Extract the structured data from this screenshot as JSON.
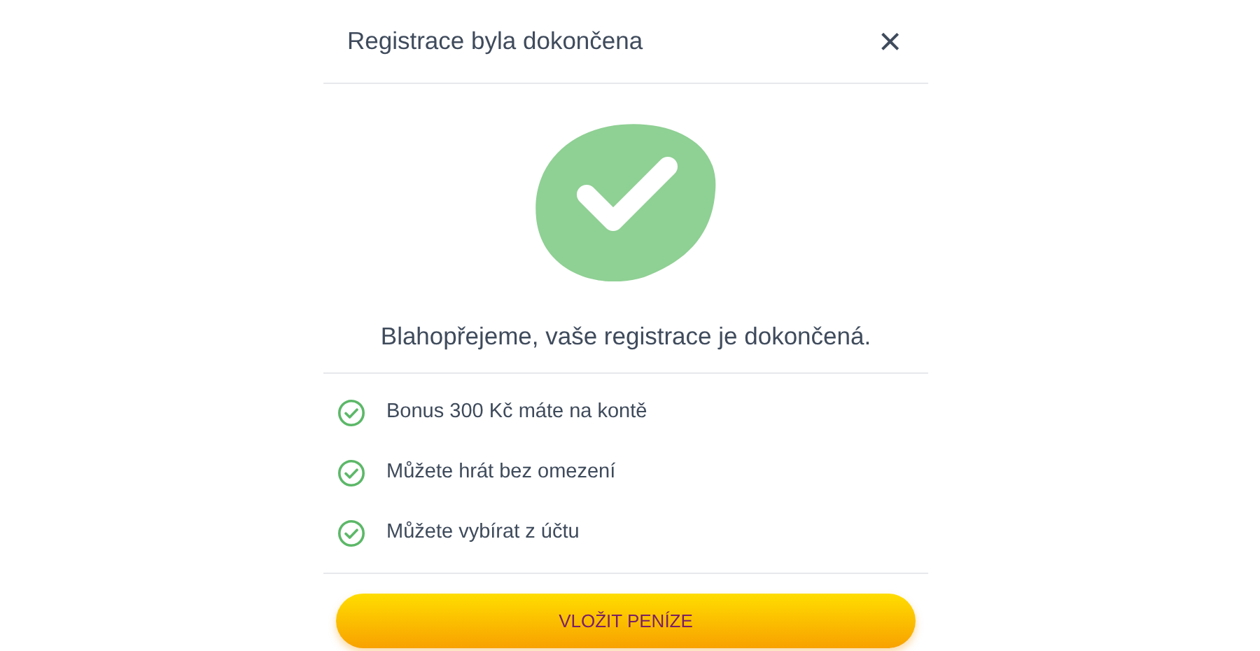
{
  "dialog": {
    "title": "Registrace byla dokončena",
    "close": "×"
  },
  "message": "Blahopřejeme, vaše registrace je dokončená.",
  "benefits": [
    {
      "text": "Bonus 300 Kč máte na kontě"
    },
    {
      "text": "Můžete hrát bez omezení"
    },
    {
      "text": "Můžete vybírat z účtu"
    }
  ],
  "button": "VLOŽIT PENÍZE"
}
